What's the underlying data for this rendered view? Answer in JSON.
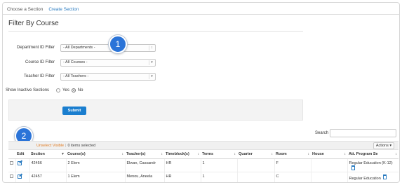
{
  "topnav": {
    "items": [
      "Choose a Section",
      "Create Section"
    ]
  },
  "page_title": "Filter By Course",
  "filters": [
    {
      "label": "Department ID Filter",
      "value": "- All Departments -"
    },
    {
      "label": "Course ID Filter",
      "value": "- All Courses -"
    },
    {
      "label": "Teacher ID Filter",
      "value": "- All Teachers -"
    }
  ],
  "inactive": {
    "label": "Show Inactive Sections",
    "options": [
      "Yes",
      "No"
    ],
    "selected": "No"
  },
  "submit_label": "Submit",
  "callouts": [
    "1",
    "2"
  ],
  "search": {
    "label": "Search",
    "value": ""
  },
  "toolbar": {
    "unselect_label": "Unselect Visible",
    "separator": "|",
    "selected_count": "0 items selected",
    "actions_label": "Actions ▾"
  },
  "table": {
    "columns": [
      "",
      "Edit",
      "Section",
      "Course(s)",
      "Teacher(s)",
      "Timeblock(s)",
      "Terms",
      "Quarter",
      "Room",
      "House",
      "Att. Program Se"
    ],
    "rows": [
      {
        "section": "42456",
        "course": "2 Elem",
        "teacher": "Elwan, Cassandr",
        "timeblock": "HR",
        "terms": "1",
        "quarter": "",
        "room": "F",
        "house": "",
        "program": "Regular Education (K-12)"
      },
      {
        "section": "42457",
        "course": "1 Elem",
        "teacher": "Menou, Aneela",
        "timeblock": "HR",
        "terms": "1",
        "quarter": "",
        "room": "C",
        "house": "",
        "program": "Regular Education"
      }
    ]
  },
  "icons": {
    "edit": "edit-icon",
    "delete": "trash-icon",
    "sort": "sort-icon"
  }
}
